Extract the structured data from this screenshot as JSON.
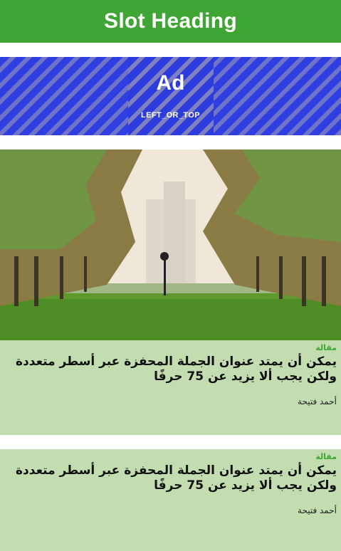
{
  "slot": {
    "heading": "Slot Heading"
  },
  "ad": {
    "title": "Ad",
    "position_label": "LEFT_OR_TOP"
  },
  "articles": [
    {
      "kicker": "مقالة",
      "headline": "يمكن أن يمتد عنوان الجملة المحفزة عبر أسطر متعددة ولكن يجب ألا يزيد عن 75 حرفًا",
      "author": "أحمد فتيحة"
    },
    {
      "kicker": "مقالة",
      "headline": "يمكن أن يمتد عنوان الجملة المحفزة عبر أسطر متعددة ولكن يجب ألا يزيد عن 75 حرفًا",
      "author": "أحمد فتيحة"
    }
  ]
}
